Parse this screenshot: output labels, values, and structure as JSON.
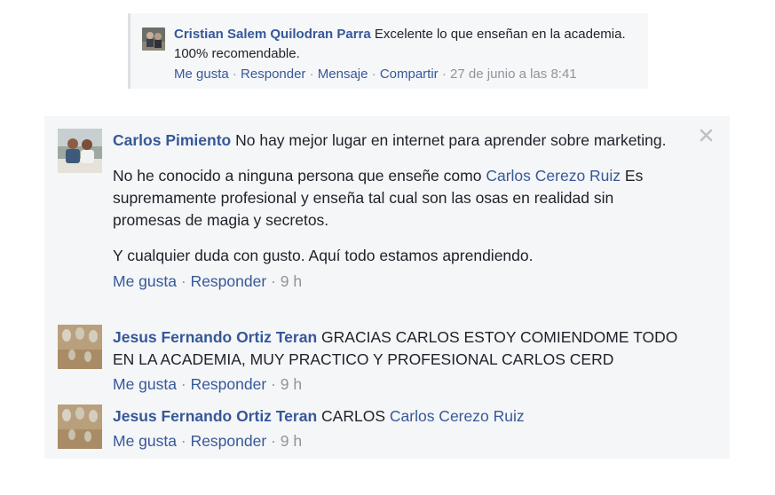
{
  "top_comment": {
    "author": "Cristian Salem Quilodran Parra",
    "text": "Excelente lo que enseñan en la academia. 100% recomendable.",
    "actions": {
      "like": "Me gusta",
      "reply": "Responder",
      "message": "Mensaje",
      "share": "Compartir"
    },
    "timestamp": "27 de junio a las 8:41"
  },
  "main_comment": {
    "author": "Carlos Pimiento",
    "text_1": "No hay mejor lugar en internet para aprender sobre marketing.",
    "text_2_prefix": "No he conocido a ninguna persona que enseñe como",
    "text_2_mention": "Carlos Cerezo Ruiz",
    "text_2_suffix": "Es supremamente profesional y enseña tal cual son las osas en realidad sin promesas de magia y secretos.",
    "text_3": "Y cualquier duda con gusto. Aquí todo estamos aprendiendo.",
    "actions": {
      "like": "Me gusta",
      "reply": "Responder"
    },
    "timestamp": "9 h"
  },
  "reply_1": {
    "author": "Jesus Fernando Ortiz Teran",
    "text": "GRACIAS CARLOS ESTOY COMIENDOME TODO EN LA ACADEMIA, MUY PRACTICO Y PROFESIONAL CARLOS CERD",
    "actions": {
      "like": "Me gusta",
      "reply": "Responder"
    },
    "timestamp": "9 h"
  },
  "reply_2": {
    "author": "Jesus Fernando Ortiz Teran",
    "text_prefix": "CARLOS",
    "mention": "Carlos Cerezo Ruiz",
    "actions": {
      "like": "Me gusta",
      "reply": "Responder"
    },
    "timestamp": "9 h"
  },
  "separator": "·",
  "close_glyph": "×"
}
